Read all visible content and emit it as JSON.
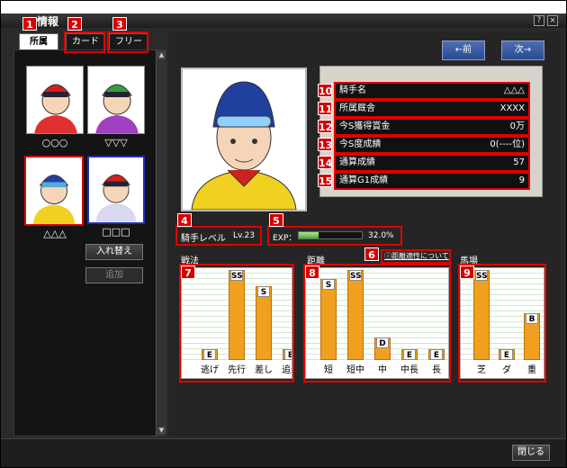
{
  "window": {
    "title": "情報",
    "help_label": "?",
    "close_label": "×",
    "close_button_label": "閉じる"
  },
  "tabs": [
    {
      "label": "所属",
      "badge": "1"
    },
    {
      "label": "カード",
      "badge": "2"
    },
    {
      "label": "フリー",
      "badge": "3"
    }
  ],
  "jockeys": [
    {
      "name": "○○○"
    },
    {
      "name": "▽▽▽"
    },
    {
      "name": "△△△"
    },
    {
      "name": "□□□"
    }
  ],
  "left_buttons": {
    "swap": "入れ替え",
    "add": "追加"
  },
  "nav": {
    "prev": "←前",
    "next": "次→"
  },
  "info": [
    {
      "badge": "10",
      "label": "騎手名",
      "value": "△△△"
    },
    {
      "badge": "11",
      "label": "所属厩舎",
      "value": "XXXX"
    },
    {
      "badge": "12",
      "label": "今S獲得賞金",
      "value": "0万"
    },
    {
      "badge": "13",
      "label": "今S度成績",
      "value": "0(----位)"
    },
    {
      "badge": "14",
      "label": "通算成績",
      "value": "57"
    },
    {
      "badge": "15",
      "label": "通算G1成績",
      "value": "9"
    }
  ],
  "level": {
    "badge": "4",
    "label": "騎手レベル",
    "value": "Lv.23"
  },
  "exp": {
    "badge": "5",
    "label": "EXP：",
    "value": "32.0%",
    "fraction": 0.32
  },
  "distance_link": {
    "badge": "6",
    "label": "距離適性について"
  },
  "stats": {
    "tactics": {
      "badge": "7",
      "title": "戦法",
      "items": [
        {
          "label": "逃げ",
          "grade": "E",
          "level": 0.12
        },
        {
          "label": "先行",
          "grade": "SS",
          "level": 1.0
        },
        {
          "label": "差し",
          "grade": "S",
          "level": 0.82
        },
        {
          "label": "追込",
          "grade": "E",
          "level": 0.12
        }
      ]
    },
    "distance": {
      "badge": "8",
      "title": "距離",
      "items": [
        {
          "label": "短",
          "grade": "S",
          "level": 0.9
        },
        {
          "label": "短中",
          "grade": "SS",
          "level": 1.0
        },
        {
          "label": "中",
          "grade": "D",
          "level": 0.25
        },
        {
          "label": "中長",
          "grade": "E",
          "level": 0.12
        },
        {
          "label": "長",
          "grade": "E",
          "level": 0.12
        }
      ]
    },
    "track": {
      "badge": "9",
      "title": "馬場",
      "items": [
        {
          "label": "芝",
          "grade": "SS",
          "level": 1.0
        },
        {
          "label": "ダ",
          "grade": "E",
          "level": 0.12
        },
        {
          "label": "重",
          "grade": "B",
          "level": 0.52
        }
      ]
    }
  },
  "colors": {
    "badge": "#d40000",
    "bar": "#f0a020",
    "exp_bar": "#6cc04a"
  }
}
